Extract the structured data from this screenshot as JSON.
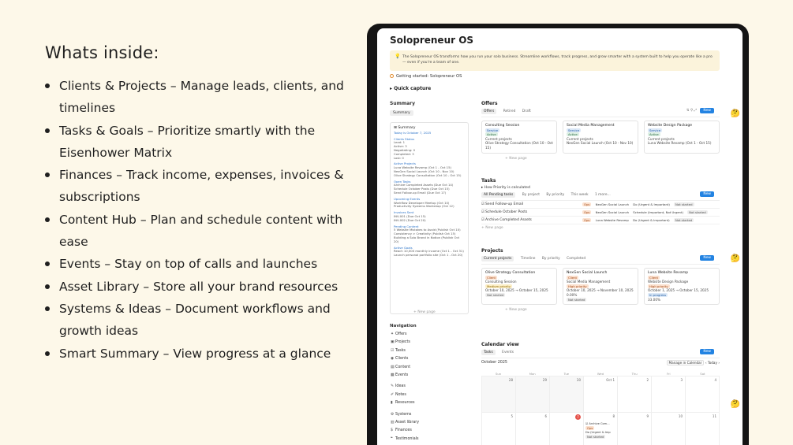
{
  "marketing": {
    "heading": "Whats inside:",
    "features": [
      "Clients & Projects – Manage leads, clients, and timelines",
      "Tasks & Goals – Prioritize smartly with the Eisenhower Matrix",
      "Finances – Track income, expenses, invoices & subscriptions",
      "Content Hub – Plan and schedule content with ease",
      "Events – Stay on top of calls and launches",
      "Asset Library – Store all your brand resources",
      "Systems & Ideas – Document workflows and growth ideas",
      "Smart Summary – View progress at a glance"
    ]
  },
  "app": {
    "title": "Solopreneur OS",
    "callout": "The Solopreneur OS transforms how you run your solo business. Streamline workflows, track progress, and grow smarter with a system built to help you operate like a pro — even if you're a team of one.",
    "getting_started": "Getting started: Solopreneur OS",
    "quick_capture": "Quick capture",
    "summary": {
      "label": "Summary",
      "view": "Summary",
      "card_title": "Summary",
      "today": "Today is October 7, 2025",
      "groups": [
        {
          "title": "Clients Status",
          "lines": [
            "Lead: 1",
            "Active: 3",
            "Negotiating: 0",
            "Completed: 3",
            "Lost: 0"
          ]
        },
        {
          "title": "Active Projects",
          "lines": [
            "Luna Website Revamp (Oct 1 - Oct 15)",
            "NexGen Social Launch (Oct 10 - Nov 10)",
            "Olive Strategy Consultation (Oct 10 - Oct 15)"
          ]
        },
        {
          "title": "Open Tasks",
          "lines": [
            "Archive Completed Assets (Due Oct 14)",
            "Schedule October Posts (Due Oct 15)",
            "Send Follow-up Email (Due Oct 17)"
          ]
        },
        {
          "title": "Upcoming Events",
          "lines": [
            "Workflow Developer Meetup (Oct 10)",
            "Productivity Systems Workshop (Oct 12)"
          ]
        },
        {
          "title": "Invoices Sent",
          "lines": [
            "INV-001 (Due Oct 15)",
            "INV-002 (Due Oct 20)"
          ]
        },
        {
          "title": "Pending Content",
          "lines": [
            "5 Website Mistakes to Avoid (Publish Oct 10)",
            "Consistency > Creativity (Publish Oct 15)",
            "Building a Solo Brand in Notion (Publish Oct 20)"
          ]
        },
        {
          "title": "Active Goals",
          "lines": [
            "Reach 10,000 monthly income (Oct 1 - Oct 31)",
            "Launch personal portfolio site (Oct 1 - Oct 20)"
          ]
        }
      ],
      "new_page": "New page"
    },
    "navigation": {
      "title": "Navigation",
      "groups": [
        [
          {
            "icon": "✦",
            "label": "Offers"
          },
          {
            "icon": "▣",
            "label": "Projects"
          },
          {
            "icon": "☑",
            "label": "Tasks"
          },
          {
            "icon": "◉",
            "label": "Clients"
          },
          {
            "icon": "▤",
            "label": "Content"
          },
          {
            "icon": "▦",
            "label": "Events"
          }
        ],
        [
          {
            "icon": "✎",
            "label": "Ideas"
          },
          {
            "icon": "✐",
            "label": "Notes"
          },
          {
            "icon": "▮",
            "label": "Resources"
          }
        ],
        [
          {
            "icon": "⚙",
            "label": "Systems"
          },
          {
            "icon": "▥",
            "label": "Asset library"
          },
          {
            "icon": "$",
            "label": "Finances"
          },
          {
            "icon": "❝",
            "label": "Testimonials"
          }
        ]
      ]
    },
    "offers": {
      "title": "Offers",
      "views": [
        "Offers",
        "Retired",
        "Draft"
      ],
      "new_label": "New",
      "cards": [
        {
          "name": "Consulting Session",
          "type": "Service",
          "status": "Active",
          "projects_label": "Current projects",
          "project": "Olive Strategy Consultation (Oct 10 - Oct 15)"
        },
        {
          "name": "Social Media Management",
          "type": "Service",
          "status": "Active",
          "projects_label": "Current projects",
          "project": "NexGen Social Launch (Oct 10 - Nov 10)"
        },
        {
          "name": "Website Design Package",
          "type": "Service",
          "status": "Active",
          "projects_label": "Current projects",
          "project": "Luna Website Revamp (Oct 1 - Oct 15)"
        }
      ],
      "new_page": "New page"
    },
    "tasks": {
      "title": "Tasks",
      "toggle": "How Priority is calculated",
      "views": [
        "All Pending tasks",
        "By project",
        "By priority",
        "This week",
        "1 more..."
      ],
      "new_label": "New",
      "rows": [
        {
          "name": "Send Follow-up Email",
          "type": "Ops",
          "project": "NexGen Social Launch",
          "priority": "Do (Urgent & Important)",
          "status": "Not started"
        },
        {
          "name": "Schedule October Posts",
          "type": "Ops",
          "project": "NexGen Social Launch",
          "priority": "Schedule (Important, Not Urgent)",
          "status": "Not started"
        },
        {
          "name": "Archive Completed Assets",
          "type": "Ops",
          "project": "Luna Website Revamp",
          "priority": "Do (Urgent & Important)",
          "status": "Not started"
        }
      ],
      "new_page": "New page"
    },
    "projects": {
      "title": "Projects",
      "views": [
        "Current projects",
        "Timeline",
        "By priority",
        "Completed"
      ],
      "new_label": "New",
      "cards": [
        {
          "name": "Olive Strategy Consultation",
          "tag": "Client",
          "offer": "Consulting Session",
          "priority": "Medium priority",
          "dates": "October 10, 2025 → October 15, 2025",
          "status": "Not started"
        },
        {
          "name": "NexGen Social Launch",
          "tag": "Client",
          "offer": "Social Media Management",
          "priority": "High priority",
          "dates": "October 10, 2025 → November 10, 2025",
          "progress": "0.00%",
          "status": "Not started"
        },
        {
          "name": "Luna Website Revamp",
          "tag": "Client",
          "offer": "Website Design Package",
          "priority": "High priority",
          "dates": "October 1, 2025 → October 15, 2025",
          "status": "In progress",
          "progress": "33.00%"
        }
      ],
      "new_page": "New page"
    },
    "calendar": {
      "title": "Calendar view",
      "views": [
        "Tasks",
        "Events"
      ],
      "new_label": "New",
      "month": "October 2025",
      "manage": "Manage in Calendar",
      "today_btn": "Today",
      "weekdays": [
        "Sun",
        "Mon",
        "Tue",
        "Wed",
        "Thu",
        "Fri",
        "Sat"
      ],
      "week1": [
        "28",
        "29",
        "30",
        "Oct 1",
        "2",
        "3",
        "4"
      ],
      "week2": [
        "5",
        "6",
        "7",
        "8",
        "9",
        "10",
        "11"
      ],
      "event": {
        "name": "Archive Com...",
        "type": "Ops",
        "priority": "Do (Urgent & Imp",
        "status": "Not started"
      }
    }
  }
}
